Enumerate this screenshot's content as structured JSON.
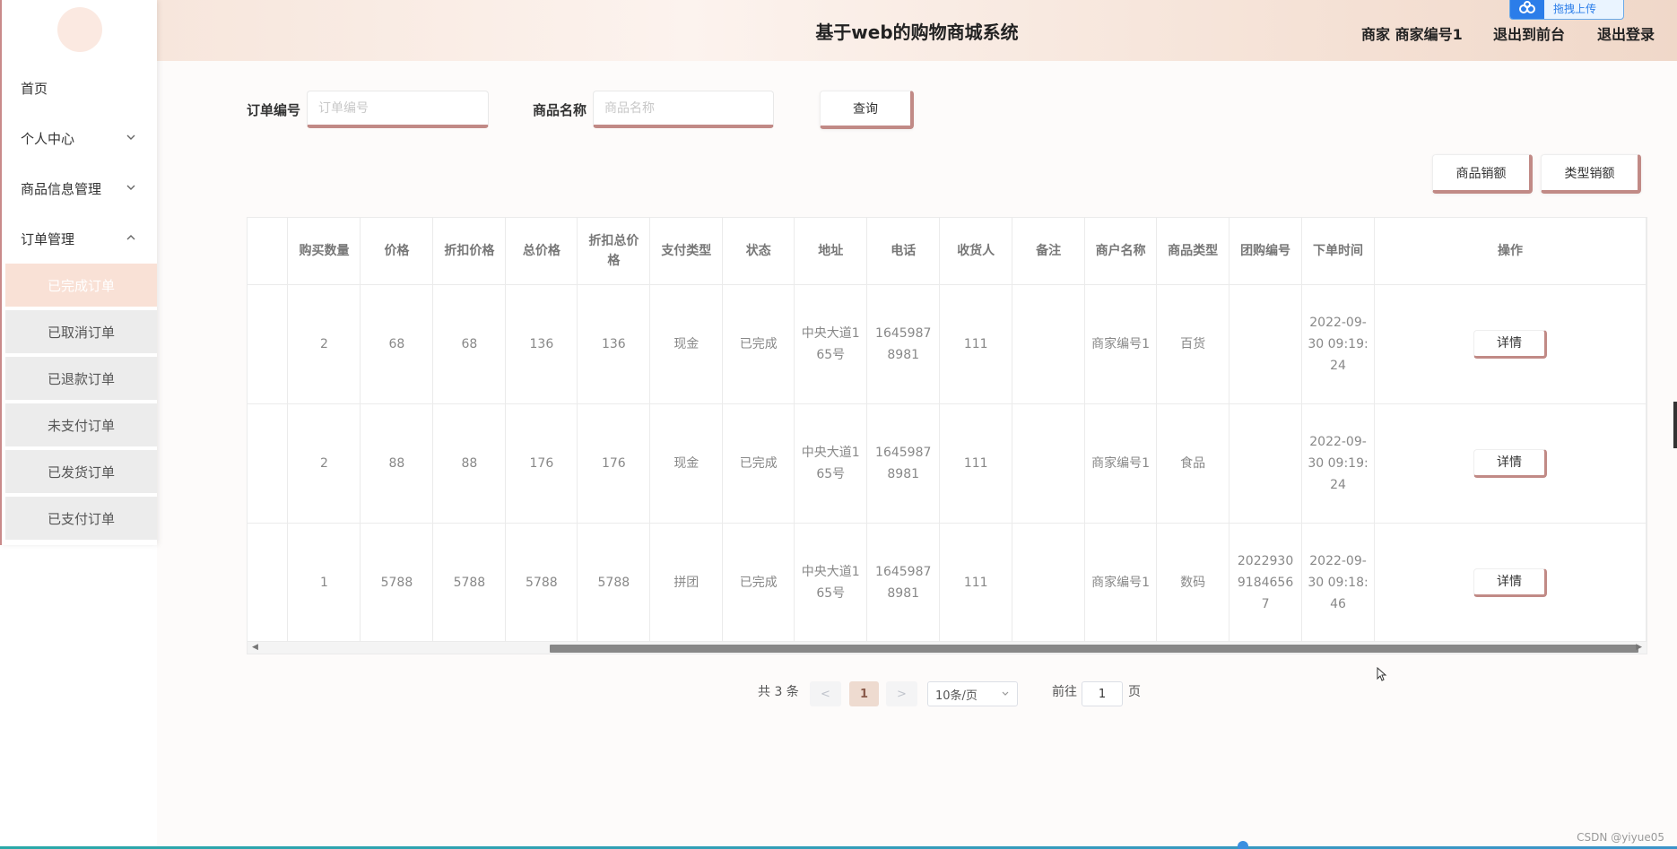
{
  "header": {
    "title": "基于web的购物商城系统",
    "user_label": "商家 商家编号1",
    "front_link": "退出到前台",
    "logout_link": "退出登录",
    "upload_label": "拖拽上传"
  },
  "sidebar": {
    "items": [
      {
        "label": "首页"
      },
      {
        "label": "个人中心"
      },
      {
        "label": "商品信息管理"
      },
      {
        "label": "订单管理"
      }
    ],
    "sub_items": [
      {
        "label": "已完成订单",
        "active": true
      },
      {
        "label": "已取消订单"
      },
      {
        "label": "已退款订单"
      },
      {
        "label": "未支付订单"
      },
      {
        "label": "已发货订单"
      },
      {
        "label": "已支付订单"
      }
    ]
  },
  "search": {
    "order_no_label": "订单编号",
    "order_no_placeholder": "订单编号",
    "order_no_value": "",
    "goods_name_label": "商品名称",
    "goods_name_placeholder": "商品名称",
    "goods_name_value": "",
    "query_label": "查询"
  },
  "actions": {
    "goods_sales_label": "商品销额",
    "type_sales_label": "类型销额"
  },
  "table": {
    "headers": [
      "购买数量",
      "价格",
      "折扣价格",
      "总价格",
      "折扣总价格",
      "支付类型",
      "状态",
      "地址",
      "电话",
      "收货人",
      "备注",
      "商户名称",
      "商品类型",
      "团购编号",
      "下单时间",
      "操作"
    ],
    "rows": [
      {
        "qty": "2",
        "price": "68",
        "disc_price": "68",
        "total": "136",
        "disc_total": "136",
        "pay_type": "现金",
        "status": "已完成",
        "address": "中央大道165号",
        "phone": "16459878981",
        "receiver": "111",
        "remark": "",
        "merchant": "商家编号1",
        "goods_type": "百货",
        "group_no": "",
        "order_time": "2022-09-30 09:19:24",
        "action": "详情"
      },
      {
        "qty": "2",
        "price": "88",
        "disc_price": "88",
        "total": "176",
        "disc_total": "176",
        "pay_type": "现金",
        "status": "已完成",
        "address": "中央大道165号",
        "phone": "16459878981",
        "receiver": "111",
        "remark": "",
        "merchant": "商家编号1",
        "goods_type": "食品",
        "group_no": "",
        "order_time": "2022-09-30 09:19:24",
        "action": "详情"
      },
      {
        "qty": "1",
        "price": "5788",
        "disc_price": "5788",
        "total": "5788",
        "disc_total": "5788",
        "pay_type": "拼团",
        "status": "已完成",
        "address": "中央大道165号",
        "phone": "16459878981",
        "receiver": "111",
        "remark": "",
        "merchant": "商家编号1",
        "goods_type": "数码",
        "group_no": "202293091846567",
        "order_time": "2022-09-30 09:18:46",
        "action": "详情"
      }
    ]
  },
  "pagination": {
    "total_text": "共 3 条",
    "prev": "<",
    "current": "1",
    "next": ">",
    "page_size": "10条/页",
    "goto_prefix": "前往",
    "goto_value": "1",
    "goto_suffix": "页"
  },
  "watermark": "CSDN @yiyue05",
  "colors": {
    "accent": "#c18a86",
    "active_menu": "#f9e1d6",
    "header_start": "#f7e6dc",
    "header_end": "#f0d8c9"
  }
}
